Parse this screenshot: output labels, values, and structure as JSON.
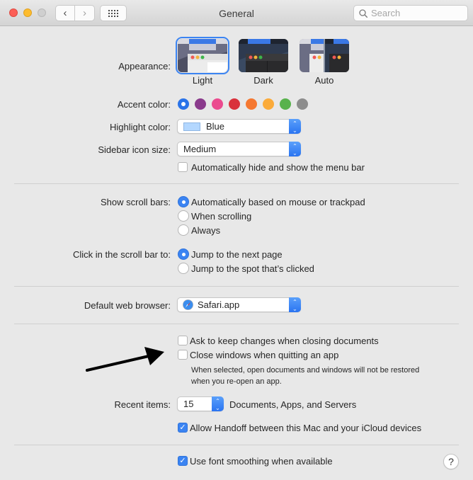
{
  "window": {
    "title": "General",
    "search_placeholder": "Search",
    "nav": {
      "back_icon": "‹",
      "forward_icon": "›"
    }
  },
  "appearance": {
    "label": "Appearance:",
    "options": [
      {
        "name": "Light",
        "selected": true
      },
      {
        "name": "Dark",
        "selected": false
      },
      {
        "name": "Auto",
        "selected": false
      }
    ]
  },
  "accent": {
    "label": "Accent color:",
    "colors": [
      "#2a73e8",
      "#8a3a8c",
      "#eb4b8f",
      "#d9313b",
      "#f57831",
      "#fbab3a",
      "#58b24c",
      "#8d8d8d"
    ],
    "selected_index": 0
  },
  "highlight": {
    "label": "Highlight color:",
    "value": "Blue",
    "swatch": "#b3d7ff"
  },
  "sidebar_icon": {
    "label": "Sidebar icon size:",
    "value": "Medium"
  },
  "menu_bar": {
    "label": "Automatically hide and show the menu bar",
    "checked": false
  },
  "scroll_bars": {
    "label": "Show scroll bars:",
    "options": [
      "Automatically based on mouse or trackpad",
      "When scrolling",
      "Always"
    ],
    "selected_index": 0
  },
  "scroll_click": {
    "label": "Click in the scroll bar to:",
    "options": [
      "Jump to the next page",
      "Jump to the spot that’s clicked"
    ],
    "selected_index": 0
  },
  "browser": {
    "label": "Default web browser:",
    "value": "Safari.app"
  },
  "documents": {
    "ask_keep": {
      "label": "Ask to keep changes when closing documents",
      "checked": false
    },
    "close_windows": {
      "label": "Close windows when quitting an app",
      "checked": false
    },
    "note_line1": "When selected, open documents and windows will not be restored",
    "note_line2": "when you re-open an app."
  },
  "recent": {
    "label": "Recent items:",
    "value": "15",
    "suffix": "Documents, Apps, and Servers"
  },
  "handoff": {
    "label": "Allow Handoff between this Mac and your iCloud devices",
    "checked": true
  },
  "font_smoothing": {
    "label": "Use font smoothing when available",
    "checked": true
  },
  "help": {
    "glyph": "?"
  },
  "checkmark": "✓"
}
